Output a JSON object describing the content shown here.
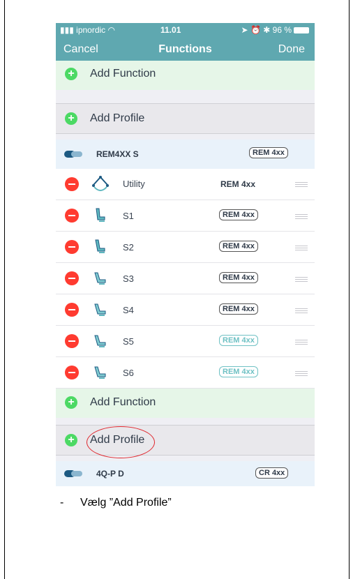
{
  "status_bar": {
    "carrier": "ipnordic",
    "time": "11.01",
    "battery": "96 %"
  },
  "nav": {
    "cancel": "Cancel",
    "title": "Functions",
    "done": "Done"
  },
  "add_function_label": "Add Function",
  "add_profile_label": "Add Profile",
  "group1": {
    "name": "REM4XX S",
    "badge": "REM 4xx"
  },
  "items": [
    {
      "label": "Utility",
      "badge": "REM 4xx",
      "badge_style": "plain"
    },
    {
      "label": "S1",
      "badge": "REM 4xx",
      "badge_style": "outline"
    },
    {
      "label": "S2",
      "badge": "REM 4xx",
      "badge_style": "outline"
    },
    {
      "label": "S3",
      "badge": "REM 4xx",
      "badge_style": "outline"
    },
    {
      "label": "S4",
      "badge": "REM 4xx",
      "badge_style": "outline"
    },
    {
      "label": "S5",
      "badge": "REM 4xx",
      "badge_style": "faded"
    },
    {
      "label": "S6",
      "badge": "REM 4xx",
      "badge_style": "faded"
    }
  ],
  "group2": {
    "name": "4Q-P D",
    "badge": "CR 4xx"
  },
  "caption": {
    "dash": "-",
    "text": "Vælg ”Add Profile”"
  },
  "colors": {
    "nav_bg": "#5fa8b0",
    "add_green": "#4cd964",
    "remove_red": "#ff3b30",
    "annotation_red": "#e0262d"
  }
}
